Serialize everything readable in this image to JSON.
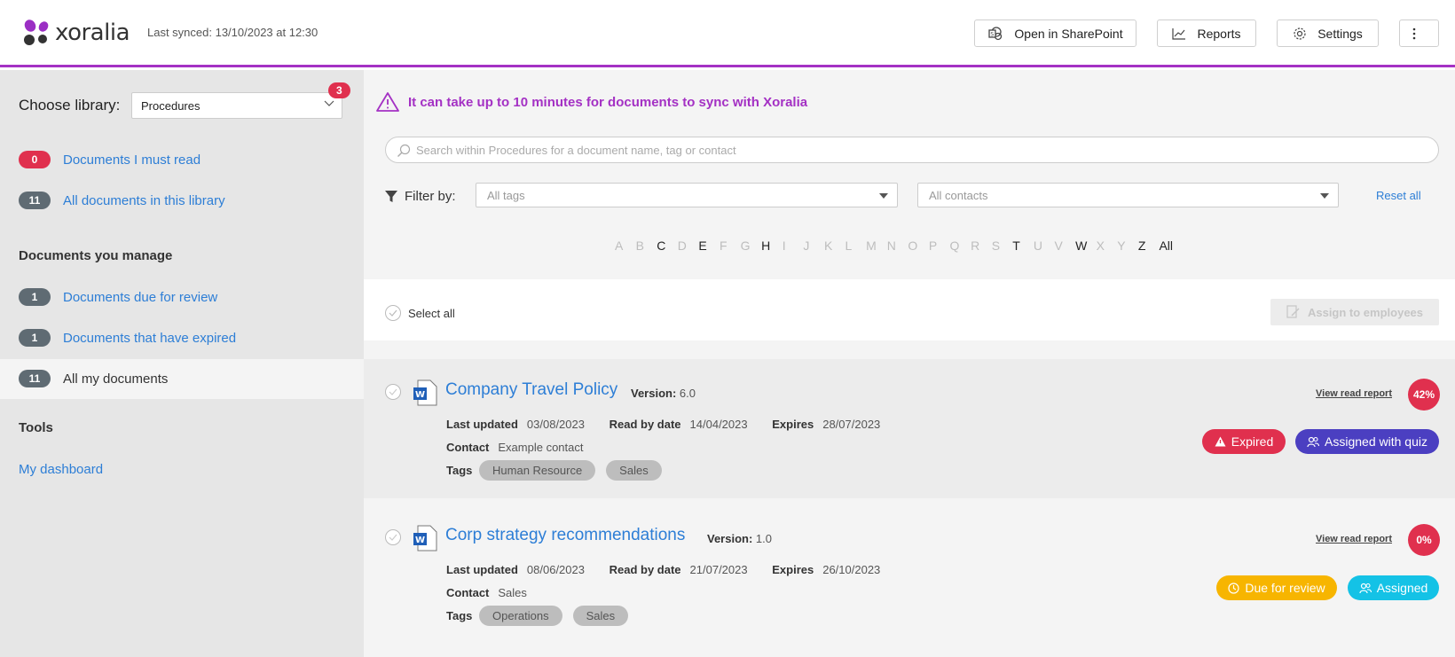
{
  "app": {
    "brand": "xoralia",
    "last_synced": "Last synced: 13/10/2023 at 12:30"
  },
  "header": {
    "open_sharepoint": "Open in SharePoint",
    "reports": "Reports",
    "settings": "Settings"
  },
  "sidebar": {
    "choose_library_label": "Choose library:",
    "library_selected": "Procedures",
    "library_badge": "3",
    "must_read": {
      "count": "0",
      "label": "Documents I must read"
    },
    "all_in_library": {
      "count": "11",
      "label": "All documents in this library"
    },
    "manage_heading": "Documents you manage",
    "due_review": {
      "count": "1",
      "label": "Documents due for review"
    },
    "expired": {
      "count": "1",
      "label": "Documents that have expired"
    },
    "all_mine": {
      "count": "11",
      "label": "All my documents"
    },
    "tools_heading": "Tools",
    "dashboard": "My dashboard"
  },
  "main": {
    "warning": "It can take up to 10 minutes for documents to sync with Xoralia",
    "search_placeholder": "Search within Procedures for a document name, tag or contact",
    "filter_label": "Filter by:",
    "tags_placeholder": "All tags",
    "contacts_placeholder": "All contacts",
    "reset": "Reset all",
    "alphabet": [
      {
        "l": "A",
        "on": false
      },
      {
        "l": "B",
        "on": false
      },
      {
        "l": "C",
        "on": true
      },
      {
        "l": "D",
        "on": false
      },
      {
        "l": "E",
        "on": true
      },
      {
        "l": "F",
        "on": false
      },
      {
        "l": "G",
        "on": false
      },
      {
        "l": "H",
        "on": true
      },
      {
        "l": "I",
        "on": false
      },
      {
        "l": "J",
        "on": false
      },
      {
        "l": "K",
        "on": false
      },
      {
        "l": "L",
        "on": false
      },
      {
        "l": "M",
        "on": false
      },
      {
        "l": "N",
        "on": false
      },
      {
        "l": "O",
        "on": false
      },
      {
        "l": "P",
        "on": false
      },
      {
        "l": "Q",
        "on": false
      },
      {
        "l": "R",
        "on": false
      },
      {
        "l": "S",
        "on": false
      },
      {
        "l": "T",
        "on": true
      },
      {
        "l": "U",
        "on": false
      },
      {
        "l": "V",
        "on": false
      },
      {
        "l": "W",
        "on": true
      },
      {
        "l": "X",
        "on": false
      },
      {
        "l": "Y",
        "on": false
      },
      {
        "l": "Z",
        "on": true
      },
      {
        "l": "All",
        "on": true
      }
    ],
    "select_all": "Select all",
    "assign_btn": "Assign to employees"
  },
  "labels": {
    "version": "Version:",
    "last_updated": "Last updated",
    "read_by": "Read by date",
    "expires": "Expires",
    "contact": "Contact",
    "tags": "Tags",
    "view_report": "View read report"
  },
  "documents": [
    {
      "title": "Company Travel Policy",
      "version": "6.0",
      "last_updated": "03/08/2023",
      "read_by": "14/04/2023",
      "expires": "28/07/2023",
      "contact": "Example contact",
      "tags": [
        "Human Resource",
        "Sales"
      ],
      "percent": "42%",
      "status1": "Expired",
      "status2": "Assigned with quiz"
    },
    {
      "title": "Corp strategy recommendations",
      "version": "1.0",
      "last_updated": "08/06/2023",
      "read_by": "21/07/2023",
      "expires": "26/10/2023",
      "contact": "Sales",
      "tags": [
        "Operations",
        "Sales"
      ],
      "percent": "0%",
      "status1": "Due for review",
      "status2": "Assigned"
    }
  ],
  "colors": {
    "accent": "#a431c4",
    "link": "#2d7ed6",
    "danger": "#e0304e",
    "quiz": "#4b3fc1",
    "review": "#f7b500",
    "assigned": "#14c2e6"
  }
}
